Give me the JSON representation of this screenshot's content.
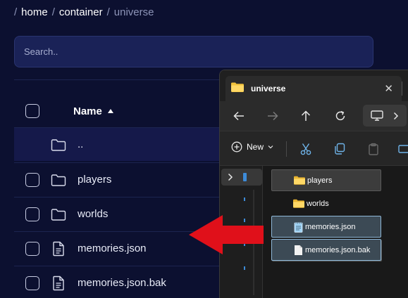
{
  "breadcrumb": {
    "separator": "/",
    "items": [
      {
        "label": "home"
      },
      {
        "label": "container"
      },
      {
        "label": "universe"
      }
    ]
  },
  "search": {
    "placeholder": "Search.."
  },
  "table": {
    "header": {
      "name": "Name",
      "sort": "ascending"
    },
    "rows": [
      {
        "name": "..",
        "type": "parent-folder",
        "icon": "folder-icon"
      },
      {
        "name": "players",
        "type": "folder",
        "icon": "folder-icon"
      },
      {
        "name": "worlds",
        "type": "folder",
        "icon": "folder-icon"
      },
      {
        "name": "memories.json",
        "type": "file",
        "icon": "file-icon"
      },
      {
        "name": "memories.json.bak",
        "type": "file",
        "icon": "file-icon"
      }
    ]
  },
  "explorer": {
    "tab_title": "universe",
    "new_label": "New",
    "items": [
      {
        "name": "players",
        "icon": "folder-icon",
        "state": "selected"
      },
      {
        "name": "worlds",
        "icon": "folder-icon",
        "state": "normal"
      },
      {
        "name": "memories.json",
        "icon": "notepad-file-icon",
        "state": "selected"
      },
      {
        "name": "memories.json.bak",
        "icon": "blank-file-icon",
        "state": "selected"
      }
    ]
  },
  "annotation": {
    "icon": "red-arrow-left",
    "color": "#e0101a"
  },
  "colors": {
    "background": "#0c1030",
    "search_bg": "#1a2257",
    "folder_yellow": "#f3c33c",
    "selection_blue": "#8fb8d8"
  }
}
